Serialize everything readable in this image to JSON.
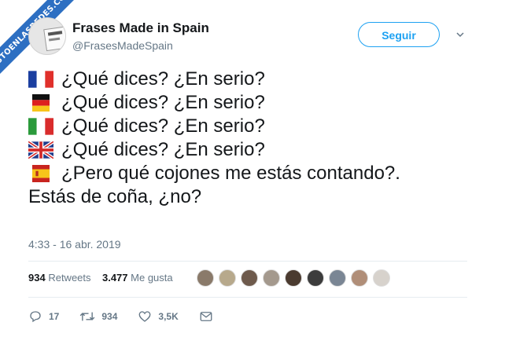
{
  "watermark": {
    "text": "VISTOENLASREDES.COM"
  },
  "profile": {
    "name": "Frases Made in Spain",
    "handle": "@FrasesMadeSpain",
    "follow_label": "Seguir"
  },
  "tweet": {
    "lines": [
      {
        "flag": "france-flag-icon",
        "text": "¿Qué dices? ¿En serio?"
      },
      {
        "flag": "germany-flag-icon",
        "text": "¿Qué dices? ¿En serio?"
      },
      {
        "flag": "italy-flag-icon",
        "text": "¿Qué dices? ¿En serio?"
      },
      {
        "flag": "uk-flag-icon",
        "text": "¿Qué dices? ¿En serio?"
      },
      {
        "flag": "spain-flag-icon",
        "text": "¿Pero qué cojones me estás contando?."
      },
      {
        "flag": "",
        "text": "Estás de coña, ¿no?"
      }
    ],
    "timestamp": "4:33 - 16 abr. 2019"
  },
  "stats": {
    "retweets_count": "934",
    "retweets_label": "Retweets",
    "likes_count": "3.477",
    "likes_label": "Me gusta"
  },
  "actions": {
    "replies": "17",
    "retweets": "934",
    "likes": "3,5K"
  },
  "colors": {
    "accent": "#1da1f2",
    "ribbon": "#2d6fc2",
    "text": "#14171a",
    "muted": "#657786"
  }
}
